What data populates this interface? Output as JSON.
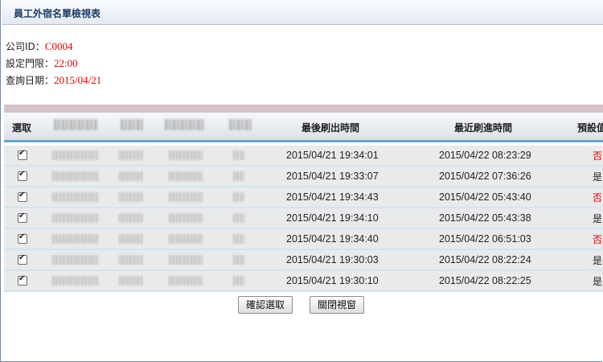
{
  "window": {
    "title": "員工外宿名單檢視表"
  },
  "info": {
    "company_label": "公司ID：",
    "company_value": "C0004",
    "curfew_label": "設定門限：",
    "curfew_value": "22:00",
    "query_label": "查詢日期：",
    "query_value": "2015/04/21"
  },
  "table": {
    "headers": {
      "select": "選取",
      "last_out": "最後刷出時間",
      "recent_in": "最近刷進時間",
      "preset": "預設值"
    },
    "rows": [
      {
        "checked": true,
        "last_out": "2015/04/21 19:34:01",
        "recent_in": "2015/04/22 08:23:29",
        "flag": "否",
        "flag_color": "#dd0000"
      },
      {
        "checked": true,
        "last_out": "2015/04/21 19:33:07",
        "recent_in": "2015/04/22 07:36:26",
        "flag": "是",
        "flag_color": "#222222"
      },
      {
        "checked": true,
        "last_out": "2015/04/21 19:34:43",
        "recent_in": "2015/04/22 05:43:40",
        "flag": "否",
        "flag_color": "#dd0000"
      },
      {
        "checked": true,
        "last_out": "2015/04/21 19:34:10",
        "recent_in": "2015/04/22 05:43:38",
        "flag": "是",
        "flag_color": "#222222"
      },
      {
        "checked": true,
        "last_out": "2015/04/21 19:34:40",
        "recent_in": "2015/04/22 06:51:03",
        "flag": "否",
        "flag_color": "#dd0000"
      },
      {
        "checked": true,
        "last_out": "2015/04/21 19:30:03",
        "recent_in": "2015/04/22 08:22:24",
        "flag": "是",
        "flag_color": "#222222"
      },
      {
        "checked": true,
        "last_out": "2015/04/21 19:30:10",
        "recent_in": "2015/04/22 08:22:25",
        "flag": "是",
        "flag_color": "#222222"
      }
    ]
  },
  "buttons": {
    "confirm": "確認選取",
    "close": "關閉視窗"
  }
}
